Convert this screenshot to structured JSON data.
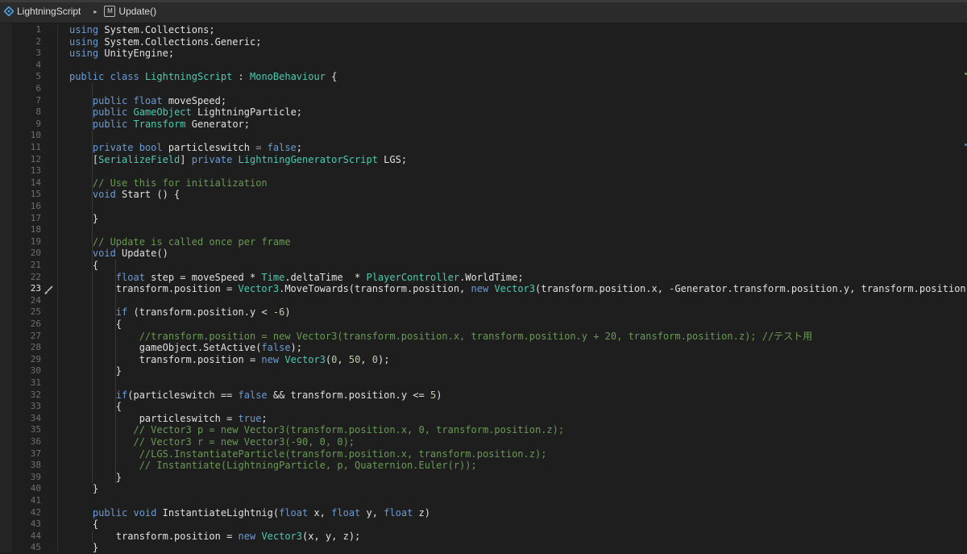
{
  "breadcrumb": {
    "file_name": "LightningScript",
    "separator": "▸",
    "method_icon_glyph": "M",
    "method_name": "Update()"
  },
  "colors": {
    "keyword": "#6b9bd3",
    "type": "#4ec9b0",
    "comment": "#6a9955",
    "number": "#b5cea8",
    "text": "#e0e0e0",
    "background": "#1e1e1e"
  },
  "editor": {
    "current_line": 23,
    "lines": [
      [
        [
          "kw",
          "using"
        ],
        [
          "t",
          " System.Collections;"
        ]
      ],
      [
        [
          "kw",
          "using"
        ],
        [
          "t",
          " System.Collections.Generic;"
        ]
      ],
      [
        [
          "kw",
          "using"
        ],
        [
          "t",
          " UnityEngine;"
        ]
      ],
      [],
      [
        [
          "kw",
          "public class"
        ],
        [
          "t",
          " "
        ],
        [
          "ty",
          "LightningScript"
        ],
        [
          "t",
          " : "
        ],
        [
          "ty",
          "MonoBehaviour"
        ],
        [
          "t",
          " {"
        ]
      ],
      [],
      [
        [
          "t",
          "    "
        ],
        [
          "kw",
          "public float"
        ],
        [
          "t",
          " moveSpeed;"
        ]
      ],
      [
        [
          "t",
          "    "
        ],
        [
          "kw",
          "public"
        ],
        [
          "t",
          " "
        ],
        [
          "ty",
          "GameObject"
        ],
        [
          "t",
          " LightningParticle;"
        ]
      ],
      [
        [
          "t",
          "    "
        ],
        [
          "kw",
          "public"
        ],
        [
          "t",
          " "
        ],
        [
          "ty",
          "Transform"
        ],
        [
          "t",
          " Generator;"
        ]
      ],
      [],
      [
        [
          "t",
          "    "
        ],
        [
          "kw",
          "private bool"
        ],
        [
          "t",
          " particleswitch "
        ],
        [
          "dim",
          "= "
        ],
        [
          "kw",
          "false"
        ],
        [
          "t",
          ";"
        ]
      ],
      [
        [
          "t",
          "    ["
        ],
        [
          "ty",
          "SerializeField"
        ],
        [
          "t",
          "] "
        ],
        [
          "kw",
          "private"
        ],
        [
          "t",
          " "
        ],
        [
          "ty",
          "LightningGeneratorScript"
        ],
        [
          "t",
          " LGS;"
        ]
      ],
      [],
      [
        [
          "t",
          "    "
        ],
        [
          "cm",
          "// Use this for initialization"
        ]
      ],
      [
        [
          "t",
          "    "
        ],
        [
          "kw",
          "void"
        ],
        [
          "t",
          " Start () {"
        ]
      ],
      [],
      [
        [
          "t",
          "    }"
        ]
      ],
      [],
      [
        [
          "t",
          "    "
        ],
        [
          "cm",
          "// Update is called once per frame"
        ]
      ],
      [
        [
          "t",
          "    "
        ],
        [
          "kw",
          "void"
        ],
        [
          "t",
          " Update()"
        ]
      ],
      [
        [
          "t",
          "    {"
        ]
      ],
      [
        [
          "t",
          "        "
        ],
        [
          "kw",
          "float"
        ],
        [
          "t",
          " step = moveSpeed * "
        ],
        [
          "ty",
          "Time"
        ],
        [
          "t",
          ".deltaTime  * "
        ],
        [
          "ty",
          "PlayerController"
        ],
        [
          "t",
          ".WorldTime;"
        ]
      ],
      [
        [
          "t",
          "        transform.position = "
        ],
        [
          "ty",
          "Vector3"
        ],
        [
          "t",
          ".MoveTowards(transform.position, "
        ],
        [
          "kw",
          "new"
        ],
        [
          "t",
          " "
        ],
        [
          "ty",
          "Vector3"
        ],
        [
          "t",
          "(transform.position.x, -Generator.transform.position.y, transform.position.z),"
        ]
      ],
      [],
      [
        [
          "t",
          "        "
        ],
        [
          "kw",
          "if"
        ],
        [
          "t",
          " (transform.position.y < "
        ],
        [
          "num",
          "-6"
        ],
        [
          "t",
          ")"
        ]
      ],
      [
        [
          "t",
          "        {"
        ]
      ],
      [
        [
          "t",
          "            "
        ],
        [
          "cm",
          "//transform.position = new Vector3(transform.position.x, transform.position.y + 20, transform.position.z); //テスト用"
        ]
      ],
      [
        [
          "t",
          "            gameObject.SetActive("
        ],
        [
          "kw",
          "false"
        ],
        [
          "t",
          ");"
        ]
      ],
      [
        [
          "t",
          "            transform.position = "
        ],
        [
          "kw",
          "new"
        ],
        [
          "t",
          " "
        ],
        [
          "ty",
          "Vector3"
        ],
        [
          "t",
          "("
        ],
        [
          "num",
          "0"
        ],
        [
          "t",
          ", "
        ],
        [
          "num",
          "50"
        ],
        [
          "t",
          ", "
        ],
        [
          "num",
          "0"
        ],
        [
          "t",
          ");"
        ]
      ],
      [
        [
          "t",
          "        }"
        ]
      ],
      [],
      [
        [
          "t",
          "        "
        ],
        [
          "kw",
          "if"
        ],
        [
          "t",
          "(particleswitch == "
        ],
        [
          "kw",
          "false"
        ],
        [
          "t",
          " && transform.position.y <= "
        ],
        [
          "num",
          "5"
        ],
        [
          "t",
          ")"
        ]
      ],
      [
        [
          "t",
          "        {"
        ]
      ],
      [
        [
          "t",
          "            particleswitch = "
        ],
        [
          "kw",
          "true"
        ],
        [
          "t",
          ";"
        ]
      ],
      [
        [
          "t",
          "           "
        ],
        [
          "cm",
          "// Vector3 p = new Vector3(transform.position.x, 0, transform.position.z);"
        ]
      ],
      [
        [
          "t",
          "           "
        ],
        [
          "cm",
          "// Vector3 r = new Vector3(-90, 0, 0);"
        ]
      ],
      [
        [
          "t",
          "            "
        ],
        [
          "cm",
          "//LGS.InstantiateParticle(transform.position.x, transform.position.z);"
        ]
      ],
      [
        [
          "t",
          "            "
        ],
        [
          "cm",
          "// Instantiate(LightningParticle, p, Quaternion.Euler(r));"
        ]
      ],
      [
        [
          "t",
          "        }"
        ]
      ],
      [
        [
          "t",
          "    }"
        ]
      ],
      [],
      [
        [
          "t",
          "    "
        ],
        [
          "kw",
          "public void"
        ],
        [
          "t",
          " InstantiateLightnig("
        ],
        [
          "kw",
          "float"
        ],
        [
          "t",
          " x, "
        ],
        [
          "kw",
          "float"
        ],
        [
          "t",
          " y, "
        ],
        [
          "kw",
          "float"
        ],
        [
          "t",
          " z)"
        ]
      ],
      [
        [
          "t",
          "    {"
        ]
      ],
      [
        [
          "t",
          "        transform.position = "
        ],
        [
          "kw",
          "new"
        ],
        [
          "t",
          " "
        ],
        [
          "ty",
          "Vector3"
        ],
        [
          "t",
          "(x, y, z);"
        ]
      ],
      [
        [
          "t",
          "    }"
        ]
      ]
    ]
  }
}
